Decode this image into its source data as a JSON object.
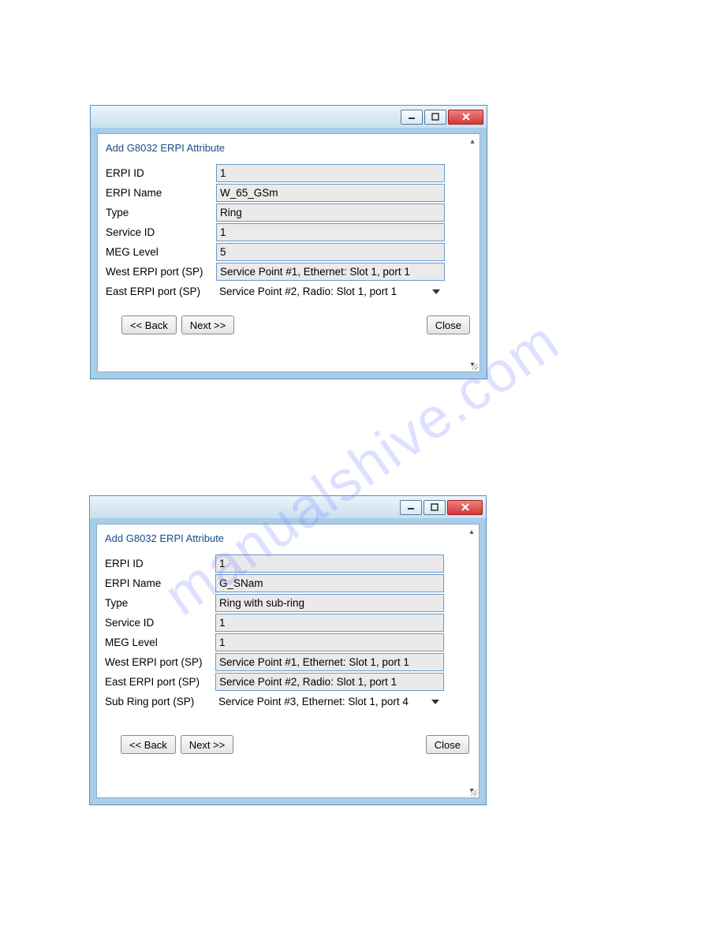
{
  "watermark": "manualshive.com",
  "dialog1": {
    "title": "Add G8032 ERPI Attribute",
    "fields": [
      {
        "label": "ERPI ID",
        "value": "1",
        "kind": "readonly"
      },
      {
        "label": "ERPI Name",
        "value": "W_65_GSm",
        "kind": "readonly"
      },
      {
        "label": "Type",
        "value": "Ring",
        "kind": "readonly"
      },
      {
        "label": "Service ID",
        "value": "1",
        "kind": "readonly"
      },
      {
        "label": "MEG Level",
        "value": "5",
        "kind": "readonly"
      },
      {
        "label": "West ERPI port (SP)",
        "value": "Service Point #1, Ethernet: Slot 1, port 1",
        "kind": "readonly"
      },
      {
        "label": "East ERPI port (SP)",
        "value": "Service Point #2, Radio: Slot 1, port 1",
        "kind": "select"
      }
    ],
    "buttons": {
      "back": "<< Back",
      "next": "Next >>",
      "close": "Close"
    }
  },
  "dialog2": {
    "title": "Add G8032 ERPI Attribute",
    "fields": [
      {
        "label": "ERPI ID",
        "value": "1",
        "kind": "readonly"
      },
      {
        "label": "ERPI Name",
        "value": "G_SNam",
        "kind": "readonly"
      },
      {
        "label": "Type",
        "value": "Ring with sub-ring",
        "kind": "readonly"
      },
      {
        "label": "Service ID",
        "value": "1",
        "kind": "readonly"
      },
      {
        "label": "MEG Level",
        "value": "1",
        "kind": "readonly"
      },
      {
        "label": "West ERPI port (SP)",
        "value": "Service Point #1, Ethernet: Slot 1, port 1",
        "kind": "readonly"
      },
      {
        "label": "East ERPI port (SP)",
        "value": "Service Point #2, Radio: Slot 1, port 1",
        "kind": "readonly"
      },
      {
        "label": "Sub Ring port (SP)",
        "value": "Service Point #3, Ethernet: Slot 1, port 4",
        "kind": "select"
      }
    ],
    "buttons": {
      "back": "<< Back",
      "next": "Next >>",
      "close": "Close"
    }
  }
}
